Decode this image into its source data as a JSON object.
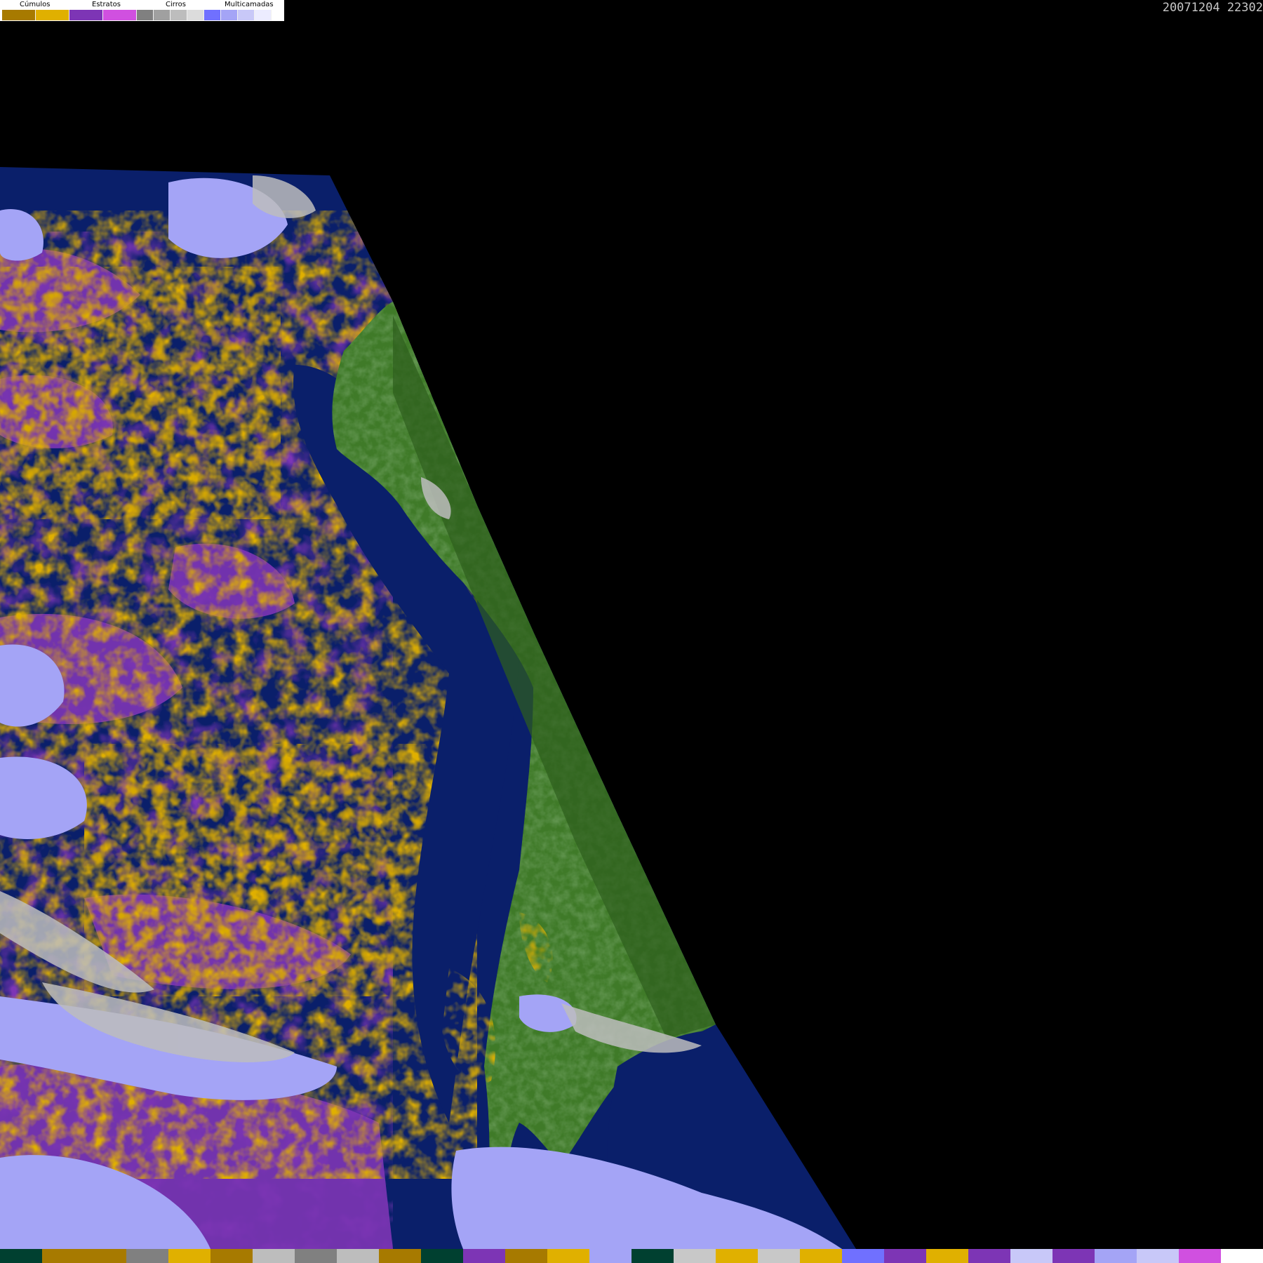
{
  "legend": {
    "groups": [
      {
        "label": "Cúmulos",
        "colors": [
          "#a77a00",
          "#e0b000"
        ]
      },
      {
        "label": "Estratos",
        "colors": [
          "#7d35b5",
          "#d050e0"
        ]
      },
      {
        "label": "Cirros",
        "colors": [
          "#808080",
          "#a0a0a0",
          "#bdbdbd",
          "#dcdcdc"
        ]
      },
      {
        "label": "Multicamadas",
        "colors": [
          "#7070ff",
          "#a4a4f6",
          "#c8c8f8",
          "#ececff"
        ]
      }
    ]
  },
  "timestamp": "20071204 22302",
  "palette": {
    "background": "#000000",
    "ocean": "#0a1f6a",
    "land": "#3f7a28",
    "cumulus": "#e0b000",
    "stratus": "#7d35b5",
    "multilayer": "#a4a4f6",
    "cirrus": "#bdbdbd"
  },
  "bottom_strip": [
    "#004030",
    "#a77a00",
    "#a77a00",
    "#808080",
    "#e0b000",
    "#a77a00",
    "#bdbdbd",
    "#808080",
    "#bdbdbd",
    "#a77a00",
    "#004030",
    "#7d35b5",
    "#a77a00",
    "#e0b000",
    "#a4a4f6",
    "#004030",
    "#c8c8c8",
    "#e0b000",
    "#c8c8c8",
    "#e0b000",
    "#7070ff",
    "#7d35b5",
    "#e0b000",
    "#7d35b5",
    "#c8c8f8",
    "#7d35b5",
    "#a4a4f6",
    "#c8c8f8",
    "#d050e0",
    "#ffffff"
  ]
}
